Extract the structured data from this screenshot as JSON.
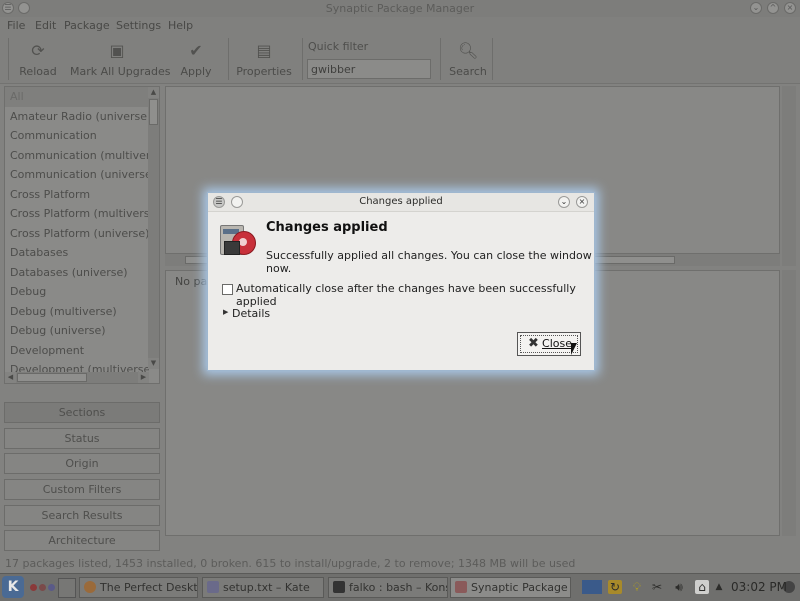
{
  "window": {
    "title": "Synaptic Package Manager"
  },
  "menu": [
    "File",
    "Edit",
    "Package",
    "Settings",
    "Help"
  ],
  "toolbar": {
    "buttons": [
      {
        "label": "Reload",
        "icon": "reload-icon"
      },
      {
        "label": "Mark All Upgrades",
        "icon": "mark-upgrades-icon"
      },
      {
        "label": "Apply",
        "icon": "checkmark-icon"
      },
      {
        "label": "Properties",
        "icon": "properties-icon"
      },
      {
        "label": "Search",
        "icon": "search-icon"
      }
    ],
    "quick_filter_label": "Quick filter",
    "quick_filter_value": "gwibber"
  },
  "categories": {
    "items": [
      "All",
      "Amateur Radio (universe)",
      "Communication",
      "Communication (multiverse)",
      "Communication (universe)",
      "Cross Platform",
      "Cross Platform (multiverse)",
      "Cross Platform (universe)",
      "Databases",
      "Databases (universe)",
      "Debug",
      "Debug (multiverse)",
      "Debug (universe)",
      "Development",
      "Development (multiverse)"
    ],
    "selected_index": 0
  },
  "side_buttons": [
    "Sections",
    "Status",
    "Origin",
    "Custom Filters",
    "Search Results",
    "Architecture"
  ],
  "description_text": "No pac",
  "status_bar": "17 packages listed, 1453 installed, 0 broken. 615 to install/upgrade, 2 to remove; 1348 MB will be used",
  "dialog": {
    "title": "Changes applied",
    "heading": "Changes applied",
    "message": "Successfully applied all changes. You can close the window now.",
    "checkbox_label": "Automatically close after the changes have been successfully applied",
    "checkbox_checked": false,
    "details_label": "Details",
    "close_label": "Close"
  },
  "taskbar": {
    "tasks": [
      {
        "label": "The Perfect Desktop -",
        "icon": "firefox-icon"
      },
      {
        "label": "setup.txt – Kate",
        "icon": "kate-icon"
      },
      {
        "label": "falko : bash – Konsole",
        "icon": "konsole-icon"
      },
      {
        "label": "Synaptic Package Man",
        "icon": "synaptic-icon"
      }
    ],
    "active_task": 3,
    "clock": "03:02 PM"
  }
}
